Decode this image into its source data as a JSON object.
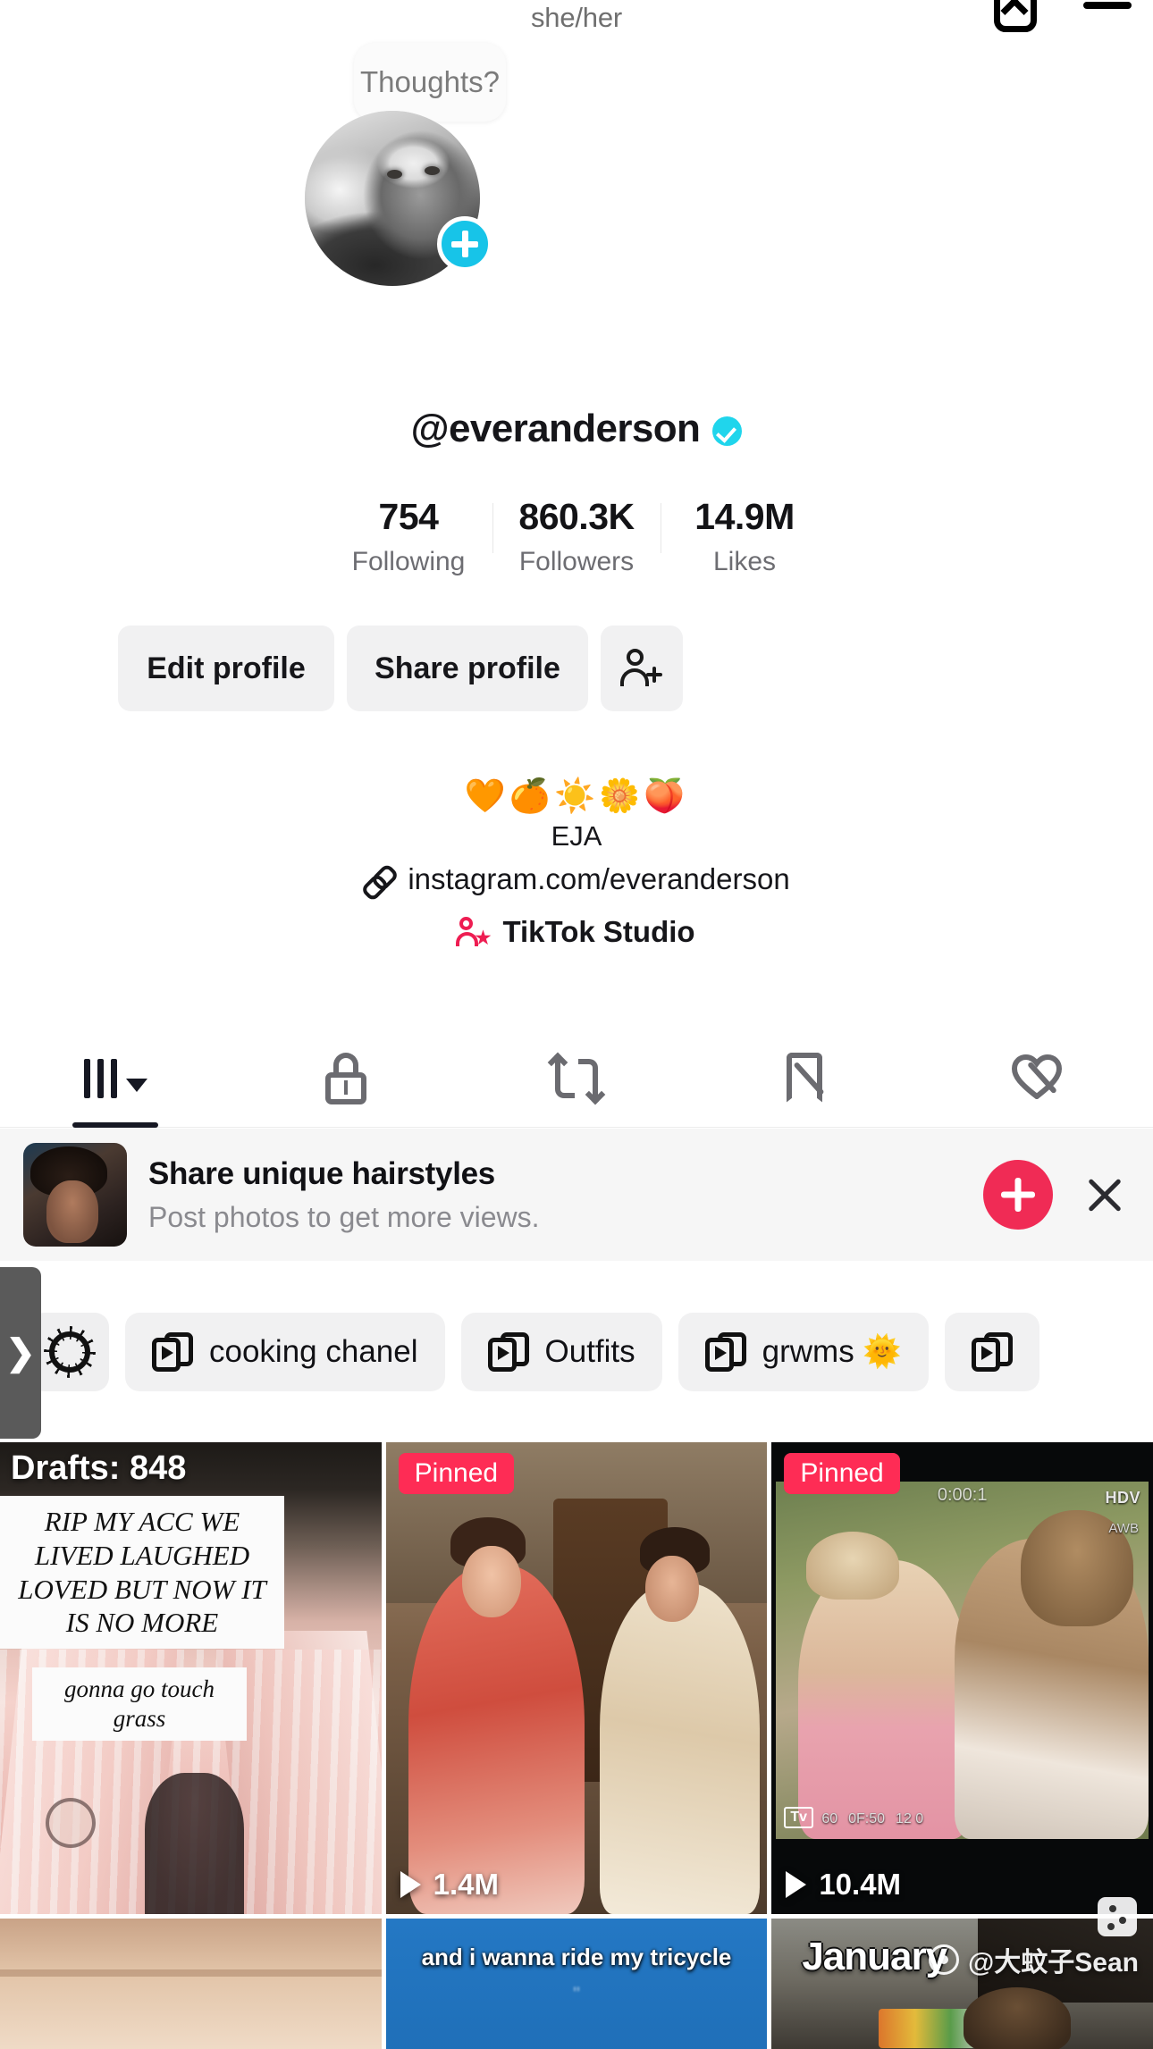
{
  "header": {
    "pronouns": "she/her",
    "inbox_icon": "inbox-icon",
    "menu_icon": "menu-icon"
  },
  "bubble": {
    "text": "Thoughts?"
  },
  "profile": {
    "username": "@everanderson",
    "verified": true,
    "avatar_plus_label": "+",
    "stats": [
      {
        "num": "754",
        "label": "Following"
      },
      {
        "num": "860.3K",
        "label": "Followers"
      },
      {
        "num": "14.9M",
        "label": "Likes"
      }
    ],
    "buttons": {
      "edit": "Edit profile",
      "share": "Share profile",
      "add_friend_icon": "add-person-icon"
    },
    "bio": {
      "emojis": "🧡🍊☀️🌼🍑",
      "name": "EJA",
      "link": "instagram.com/everanderson",
      "studio": "TikTok Studio"
    }
  },
  "tabs": [
    {
      "name": "posts",
      "icon": "grid-icon",
      "active": true
    },
    {
      "name": "private",
      "icon": "lock-icon",
      "active": false
    },
    {
      "name": "reposts",
      "icon": "repost-icon",
      "active": false
    },
    {
      "name": "saved",
      "icon": "saved-hidden-icon",
      "active": false
    },
    {
      "name": "liked",
      "icon": "liked-hidden-icon",
      "active": false
    }
  ],
  "promo": {
    "title": "Share unique hairstyles",
    "subtitle": "Post photos to get more views.",
    "plus_label": "+",
    "close_label": "×"
  },
  "chips": [
    {
      "label": "",
      "icon": "sunburst-icon"
    },
    {
      "label": "cooking chanel",
      "icon": "playlist-icon"
    },
    {
      "label": "Outfits",
      "icon": "playlist-icon"
    },
    {
      "label": "grwms 🌞",
      "icon": "playlist-icon"
    }
  ],
  "side_handle": {
    "label": "❯"
  },
  "videos": [
    {
      "drafts": "Drafts: 848",
      "caption_1": "RIP MY ACC WE LIVED LAUGHED LOVED BUT NOW IT IS NO MORE",
      "caption_2": "gonna go touch grass",
      "pinned": false,
      "views": ""
    },
    {
      "pinned_label": "Pinned",
      "views": "1.4M"
    },
    {
      "pinned_label": "Pinned",
      "views": "10.4M",
      "hdv": "HDV",
      "awb": "AWB",
      "timecode": "0:00:1",
      "tv_badge": "Tv",
      "meta_left": "60",
      "meta_mid": "0F:50",
      "meta_right": "12        0"
    }
  ],
  "videos_row2": [
    {
      "overlay": ""
    },
    {
      "overlay": "and i wanna ride my tricycle",
      "overlay_sub": "\""
    },
    {
      "overlay": "January"
    }
  ],
  "watermark": {
    "text": "@大蚊子Sean"
  },
  "colors": {
    "accent_pink": "#FE2C55",
    "accent_cyan": "#20D5EC",
    "chip_bg": "#F1F1F2",
    "text_primary": "#16161A",
    "text_secondary": "#6D6D72"
  }
}
